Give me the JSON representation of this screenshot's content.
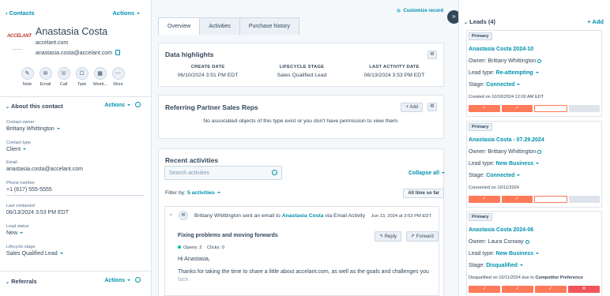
{
  "left": {
    "breadcrumb": "Contacts",
    "actions": "Actions",
    "logo_text": "ACCELANT",
    "name": "Anastasia Costa",
    "domain": "accelant.com",
    "email": "anastasia.costa@accelant.com",
    "quick_actions": [
      {
        "label": "Note",
        "icon": "note-icon",
        "glyph": "✎"
      },
      {
        "label": "Email",
        "icon": "email-icon",
        "glyph": "✉"
      },
      {
        "label": "Call",
        "icon": "phone-icon",
        "glyph": "☏"
      },
      {
        "label": "Task",
        "icon": "task-icon",
        "glyph": "☐"
      },
      {
        "label": "Meeti...",
        "icon": "calendar-icon",
        "glyph": "▦"
      },
      {
        "label": "More",
        "icon": "more-icon",
        "glyph": "⋯"
      }
    ],
    "about_title": "About this contact",
    "about_actions": "Actions",
    "props": {
      "owner_label": "Contact owner",
      "owner_value": "Brittany Whittington",
      "type_label": "Contact type",
      "type_value": "Client",
      "email_label": "Email",
      "email_value": "anastasia.costa@accelant.com",
      "phone_label": "Phone number",
      "phone_value": "+1 (617) 555-5555",
      "last_contacted_label": "Last contacted",
      "last_contacted_value": "06/13/2024 3:53 PM EDT",
      "lead_status_label": "Lead status",
      "lead_status_value": "New",
      "lifecycle_label": "Lifecycle stage",
      "lifecycle_value": "Sales Qualified Lead"
    },
    "referrals_title": "Referrals",
    "referrals_actions": "Actions"
  },
  "mid": {
    "customize": "Customize record",
    "tabs": [
      "Overview",
      "Activities",
      "Purchase history"
    ],
    "highlights": {
      "title": "Data highlights",
      "create_label": "CREATE DATE",
      "create_value": "06/10/2024 3:51 PM EDT",
      "lifecycle_label": "LIFECYCLE STAGE",
      "lifecycle_value": "Sales Qualified Lead",
      "last_label": "LAST ACTIVITY DATE",
      "last_value": "06/13/2024 3:53 PM EDT"
    },
    "referring": {
      "title": "Referring Partner Sales Reps",
      "add": "+ Add",
      "empty": "No associated objects of this type exist or you don't have permission to view them."
    },
    "recent": {
      "title": "Recent activities",
      "search_placeholder": "Search activities",
      "collapse_all": "Collapse all",
      "filter_by": "Filter by:",
      "filter_value": "5 activities",
      "all_time": "All time so far",
      "email_sender": "Brittany Whittington",
      "email_mid": "sent an email to",
      "email_recipient": "Anastasia Costa",
      "email_via": "via Email Activity",
      "email_date": "Jun 13, 2024 at 3:53 PM EDT",
      "subject": "Fixing problems and moving forwards",
      "reply": "Reply",
      "forward": "Forward",
      "opens": "Opens: 2",
      "clicks": "Clicks: 0",
      "greeting": "Hi Anastasia,",
      "body": "Thanks for taking the time to share a little about accelant.com, as well as the goals and challenges you",
      "body2": "face."
    }
  },
  "right": {
    "leads_title": "Leads (4)",
    "add": "+ Add",
    "leads": [
      {
        "badge": "Primary",
        "title": "Anastasia Costa 2024-10",
        "owner": "Owner: Brittany Whittington",
        "lead_type_label": "Lead type:",
        "lead_type": "Re-attempting",
        "stage_label": "Stage:",
        "stage": "Connected",
        "note": "Created on 10/18/2024 12:00 AM EDT",
        "segments": [
          "done",
          "done",
          "cur",
          "empty"
        ]
      },
      {
        "badge": "Primary",
        "title": "Anastasia Costa - 07.29.2024",
        "owner": "Owner: Brittany Whittington",
        "lead_type_label": "Lead type:",
        "lead_type": "New Business",
        "stage_label": "Stage:",
        "stage": "Connected",
        "note": "Connected on 10/11/2024",
        "segments": [
          "done",
          "done",
          "cur",
          "empty"
        ]
      },
      {
        "badge": "Primary",
        "title": "Anastasia Costa 2024-06",
        "owner": "Owner: Laura Conway",
        "lead_type_label": "Lead type:",
        "lead_type": "New Business",
        "stage_label": "Stage:",
        "stage": "Disqualified",
        "note": "Disqualified on 10/11/2024 due to",
        "note_reason": "Competitor Preference",
        "segments": [
          "done",
          "done",
          "done",
          "lost"
        ]
      }
    ]
  }
}
